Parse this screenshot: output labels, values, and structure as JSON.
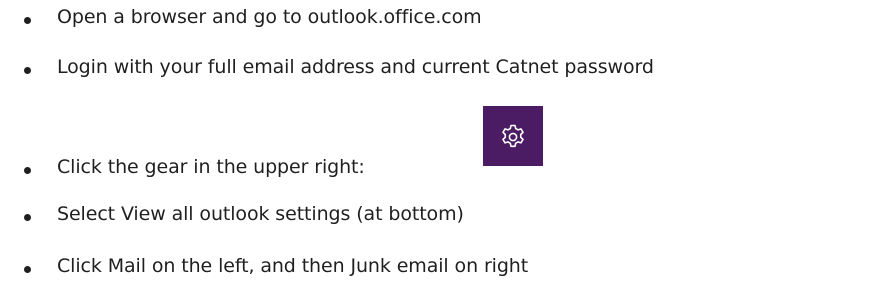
{
  "instructions": [
    {
      "text": "Open a browser and go to outlook.office.com"
    },
    {
      "text": "Login with your full email address and current Catnet password"
    },
    {
      "text": "Click the gear in the upper right:"
    },
    {
      "text": "Select View all outlook settings (at bottom)"
    },
    {
      "text": "Click Mail on the left, and then Junk email on right"
    }
  ],
  "gear_tile": {
    "icon": "gear-icon",
    "background_color": "#4b1b63",
    "icon_color": "#ffffff"
  }
}
